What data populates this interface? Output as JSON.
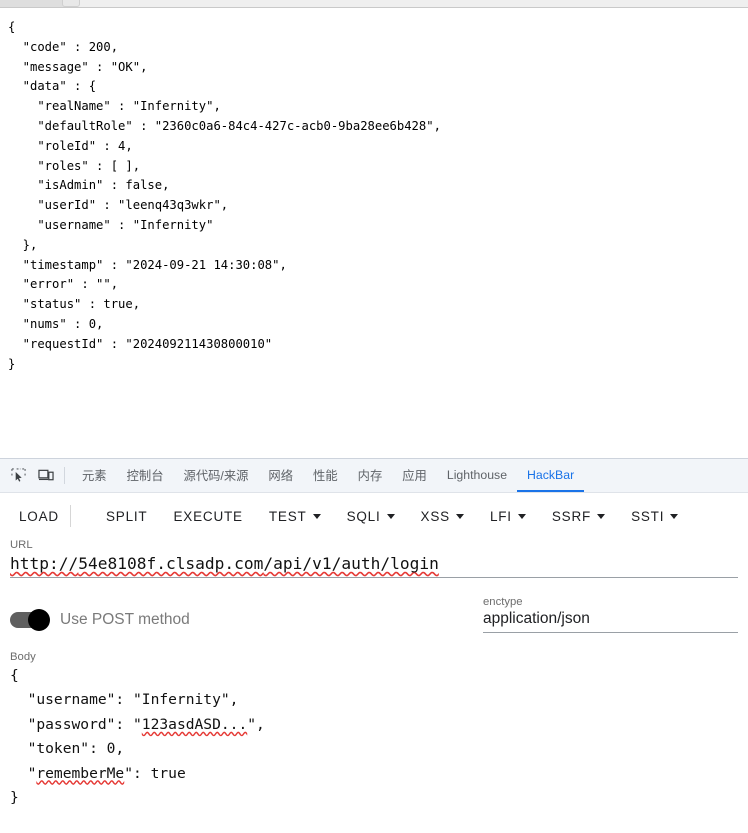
{
  "browser": {
    "chrome_strip": "cut-off-tab-bar"
  },
  "page": {
    "response_json": "{\n  \"code\" : 200,\n  \"message\" : \"OK\",\n  \"data\" : {\n    \"realName\" : \"Infernity\",\n    \"defaultRole\" : \"2360c0a6-84c4-427c-acb0-9ba28ee6b428\",\n    \"roleId\" : 4,\n    \"roles\" : [ ],\n    \"isAdmin\" : false,\n    \"userId\" : \"leenq43q3wkr\",\n    \"username\" : \"Infernity\"\n  },\n  \"timestamp\" : \"2024-09-21 14:30:08\",\n  \"error\" : \"\",\n  \"status\" : true,\n  \"nums\" : 0,\n  \"requestId\" : \"202409211430800010\"\n}",
    "response_fields": {
      "code": 200,
      "message": "OK",
      "data": {
        "realName": "Infernity",
        "defaultRole": "2360c0a6-84c4-427c-acb0-9ba28ee6b428",
        "roleId": 4,
        "roles": [],
        "isAdmin": false,
        "userId": "leenq43q3wkr",
        "username": "Infernity"
      },
      "timestamp": "2024-09-21 14:30:08",
      "error": "",
      "status": true,
      "nums": 0,
      "requestId": "202409211430800010"
    }
  },
  "devtools": {
    "icons": {
      "inspect": "inspect-element-icon",
      "device": "device-toolbar-icon"
    },
    "tabs": [
      {
        "label": "元素",
        "active": false
      },
      {
        "label": "控制台",
        "active": false
      },
      {
        "label": "源代码/来源",
        "active": false
      },
      {
        "label": "网络",
        "active": false
      },
      {
        "label": "性能",
        "active": false
      },
      {
        "label": "内存",
        "active": false
      },
      {
        "label": "应用",
        "active": false
      },
      {
        "label": "Lighthouse",
        "active": false
      },
      {
        "label": "HackBar",
        "active": true
      }
    ],
    "active_tab": "HackBar",
    "accent_color": "#1a73e8"
  },
  "hackbar": {
    "toolbar": [
      {
        "label": "LOAD",
        "caret": false
      },
      {
        "label": "SPLIT",
        "caret": false
      },
      {
        "label": "EXECUTE",
        "caret": false
      },
      {
        "label": "TEST",
        "caret": true
      },
      {
        "label": "SQLI",
        "caret": true
      },
      {
        "label": "XSS",
        "caret": true
      },
      {
        "label": "LFI",
        "caret": true
      },
      {
        "label": "SSRF",
        "caret": true
      },
      {
        "label": "SSTI",
        "caret": true
      }
    ],
    "load_dropdown_caret": "chevron-down-icon",
    "url": {
      "label": "URL",
      "value": "http://54e8108f.clsadp.com/api/v1/auth/login",
      "scheme": "http://",
      "host": "54e8108f.clsadp.com",
      "path": "/api/v1/auth/login"
    },
    "post": {
      "label": "Use POST method",
      "enabled": true
    },
    "enctype": {
      "label": "enctype",
      "value": "application/json"
    },
    "body": {
      "label": "Body",
      "value": "{\n  \"username\": \"Infernity\",\n  \"password\": \"123asdASD...\",\n  \"token\": 0,\n  \"rememberMe\": true\n}",
      "fields": {
        "username": "Infernity",
        "password": "123asdASD...",
        "token": 0,
        "rememberMe": true
      }
    }
  }
}
